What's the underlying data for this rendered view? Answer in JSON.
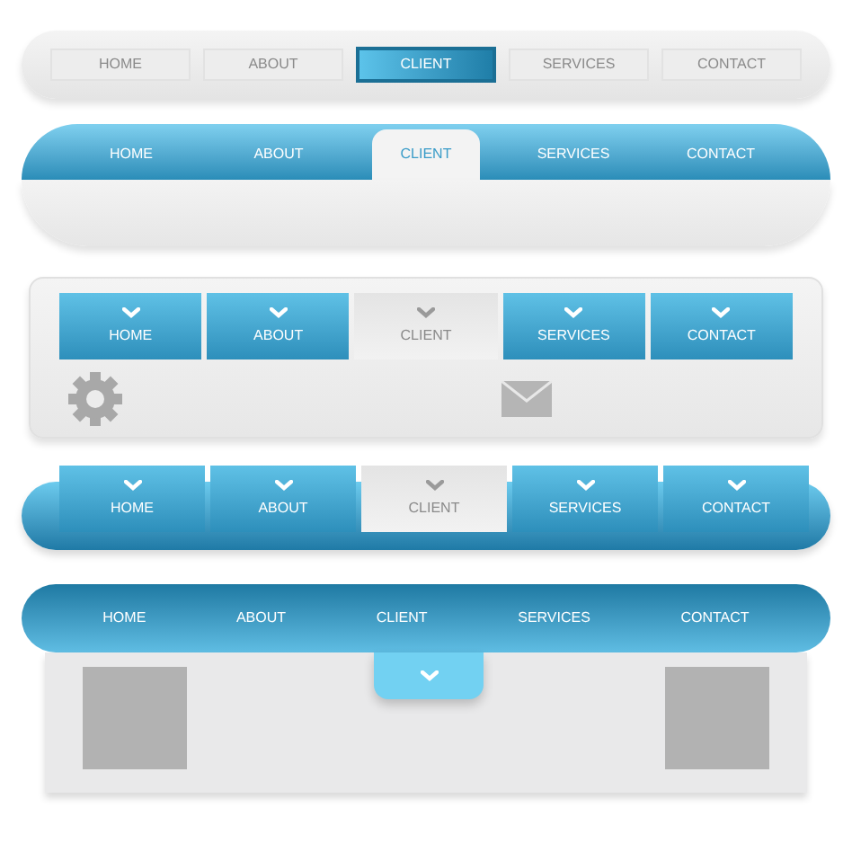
{
  "navbars": [
    {
      "kind": "pill",
      "items": [
        {
          "label": "HOME",
          "selected": false
        },
        {
          "label": "ABOUT",
          "selected": false
        },
        {
          "label": "CLIENT",
          "selected": true
        },
        {
          "label": "SERVICES",
          "selected": false
        },
        {
          "label": "CONTACT",
          "selected": false
        }
      ]
    },
    {
      "kind": "tabbed",
      "items": [
        {
          "label": "HOME",
          "selected": false
        },
        {
          "label": "ABOUT",
          "selected": false
        },
        {
          "label": "CLIENT",
          "selected": true
        },
        {
          "label": "SERVICES",
          "selected": false
        },
        {
          "label": "CONTACT",
          "selected": false
        }
      ]
    },
    {
      "kind": "panel",
      "items": [
        {
          "label": "HOME",
          "selected": false
        },
        {
          "label": "ABOUT",
          "selected": false
        },
        {
          "label": "CLIENT",
          "selected": true
        },
        {
          "label": "SERVICES",
          "selected": false
        },
        {
          "label": "CONTACT",
          "selected": false
        }
      ]
    },
    {
      "kind": "blocks",
      "items": [
        {
          "label": "HOME",
          "selected": false
        },
        {
          "label": "ABOUT",
          "selected": false
        },
        {
          "label": "CLIENT",
          "selected": true
        },
        {
          "label": "SERVICES",
          "selected": false
        },
        {
          "label": "CONTACT",
          "selected": false
        }
      ]
    },
    {
      "kind": "dropdown",
      "toggle": {
        "expanded": true
      },
      "items": [
        {
          "label": "HOME",
          "selected": false
        },
        {
          "label": "ABOUT",
          "selected": false
        },
        {
          "label": "CLIENT",
          "selected": false
        },
        {
          "label": "SERVICES",
          "selected": false
        },
        {
          "label": "CONTACT",
          "selected": false
        }
      ]
    }
  ]
}
